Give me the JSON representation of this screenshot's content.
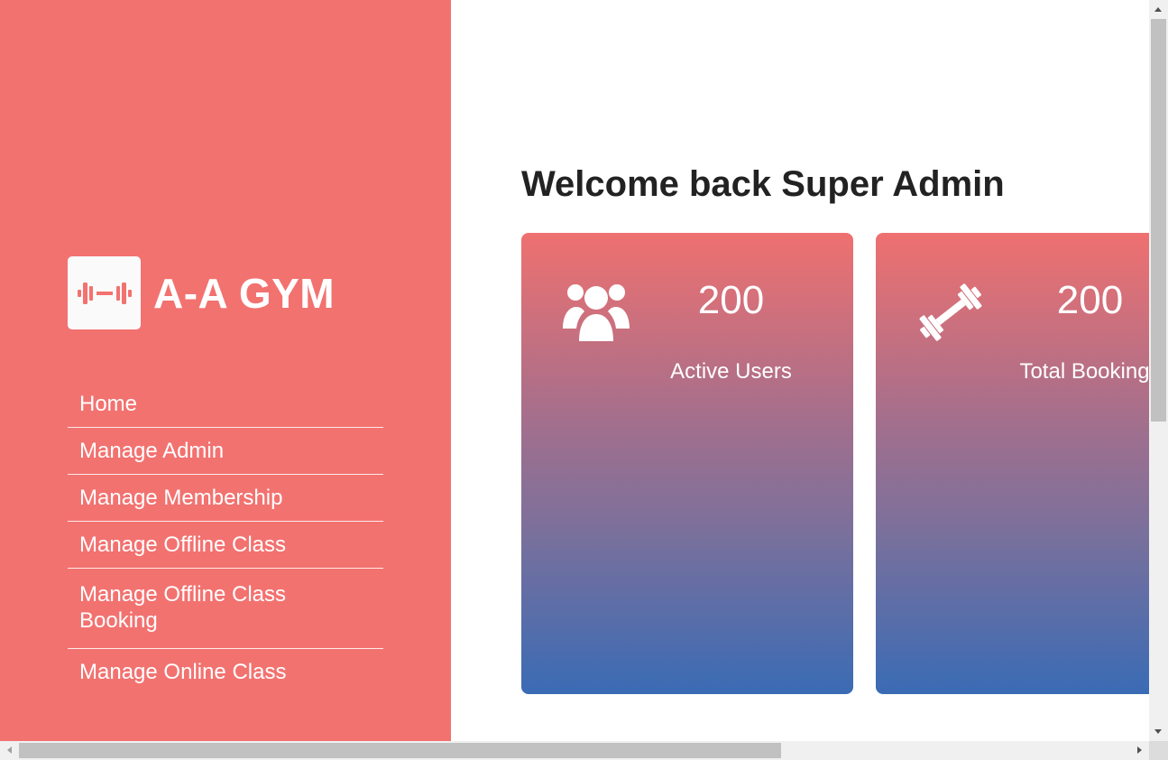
{
  "colors": {
    "sidebar_bg": "#f27270",
    "card_gradient_top": "#ef7070",
    "card_gradient_bottom": "#3a6bb5",
    "title_text": "#222222"
  },
  "sidebar": {
    "logo_icon": "dumbbell-icon",
    "brand": "A-A GYM",
    "items": [
      {
        "label": "Home"
      },
      {
        "label": "Manage Admin"
      },
      {
        "label": "Manage Membership"
      },
      {
        "label": "Manage Offline Class"
      },
      {
        "label": "Manage Offline Class Booking"
      },
      {
        "label": "Manage Online Class"
      }
    ]
  },
  "main": {
    "title": "Welcome back Super Admin",
    "cards": [
      {
        "icon": "users-icon",
        "value": "200",
        "label": "Active Users"
      },
      {
        "icon": "dumbbell-icon",
        "value": "200",
        "label": "Total Bookings"
      }
    ]
  }
}
